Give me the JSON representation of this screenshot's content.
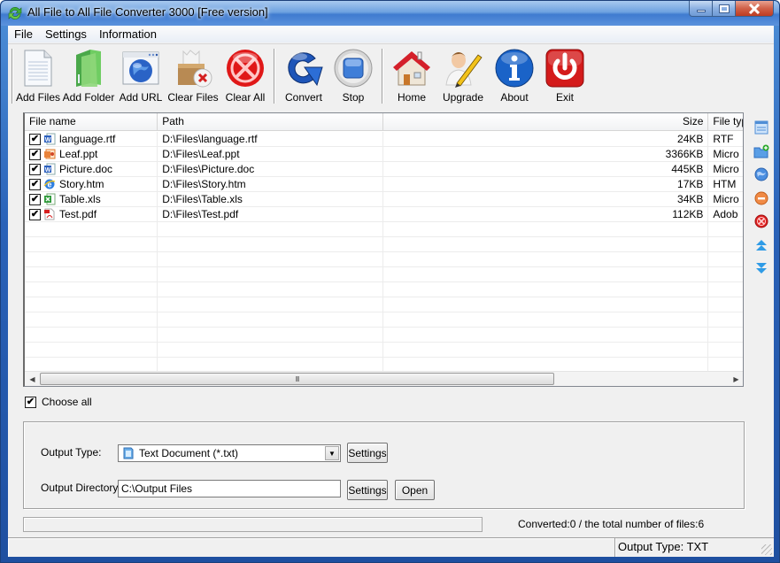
{
  "window": {
    "title": "All File to All File Converter 3000 [Free version]",
    "controls": {
      "minimize": "minimize",
      "maximize": "maximize",
      "close": "close"
    }
  },
  "menu": {
    "items": [
      {
        "label": "File"
      },
      {
        "label": "Settings"
      },
      {
        "label": "Information"
      }
    ]
  },
  "toolbar": {
    "add_files": "Add Files",
    "add_folder": "Add Folder",
    "add_url": "Add URL",
    "clear_files": "Clear Files",
    "clear_all": "Clear All",
    "convert": "Convert",
    "stop": "Stop",
    "home": "Home",
    "upgrade": "Upgrade",
    "about": "About",
    "exit": "Exit"
  },
  "file_table": {
    "columns": {
      "name": "File name",
      "path": "Path",
      "size": "Size",
      "type": "File type"
    },
    "rows": [
      {
        "checked": true,
        "icon": "word-icon",
        "name": "language.rtf",
        "path": "D:\\Files\\language.rtf",
        "size": "24KB",
        "type": "RTF"
      },
      {
        "checked": true,
        "icon": "powerpoint-icon",
        "name": "Leaf.ppt",
        "path": "D:\\Files\\Leaf.ppt",
        "size": "3366KB",
        "type": "Micro"
      },
      {
        "checked": true,
        "icon": "word-icon",
        "name": "Picture.doc",
        "path": "D:\\Files\\Picture.doc",
        "size": "445KB",
        "type": "Micro"
      },
      {
        "checked": true,
        "icon": "ie-icon",
        "name": "Story.htm",
        "path": "D:\\Files\\Story.htm",
        "size": "17KB",
        "type": "HTM"
      },
      {
        "checked": true,
        "icon": "excel-icon",
        "name": "Table.xls",
        "path": "D:\\Files\\Table.xls",
        "size": "34KB",
        "type": "Micro"
      },
      {
        "checked": true,
        "icon": "pdf-icon",
        "name": "Test.pdf",
        "path": "D:\\Files\\Test.pdf",
        "size": "112KB",
        "type": "Adob"
      }
    ],
    "empty_rows": 10,
    "scroll_grip": "III"
  },
  "side_tools": [
    "list-icon",
    "add-folder-icon",
    "globe-icon",
    "remove-icon",
    "clear-icon",
    "move-up-icon",
    "move-down-icon"
  ],
  "choose_all": {
    "label": "Choose all",
    "checked": true
  },
  "output": {
    "type_label": "Output Type:",
    "type_value": "Text Document (*.txt)",
    "type_settings": "Settings",
    "dir_label": "Output Directory:",
    "dir_value": "C:\\Output Files",
    "dir_settings": "Settings",
    "open": "Open"
  },
  "progress": {
    "fraction": 0
  },
  "converted_text": "Converted:0  /  the total number of files:6",
  "statusbar": {
    "output_type": "Output Type: TXT"
  }
}
